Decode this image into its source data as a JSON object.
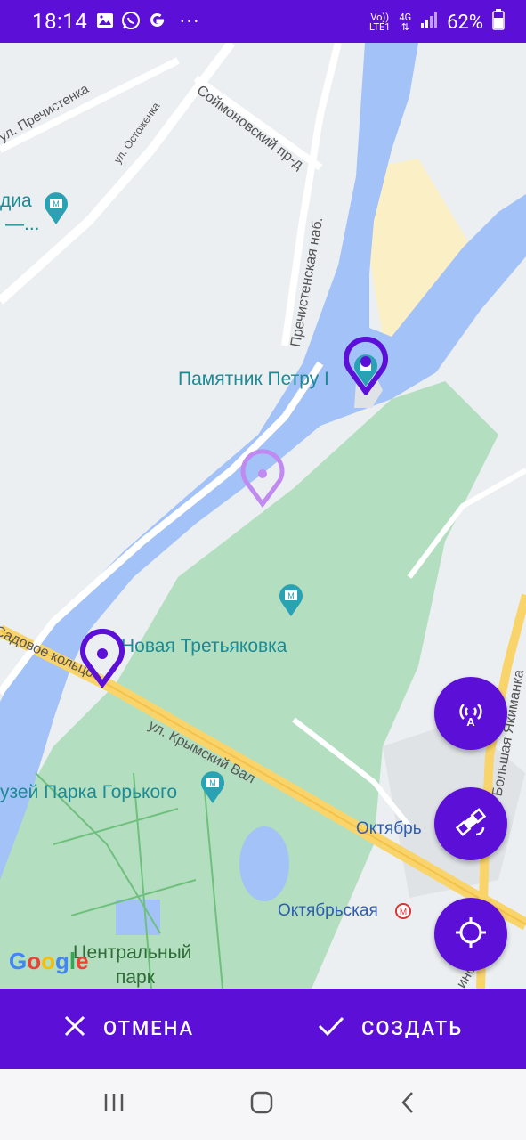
{
  "status_bar": {
    "time": "18:14",
    "network_vo": "Vo))",
    "network_lte": "LTE1",
    "network_4g": "4G",
    "battery": "62%",
    "icons": [
      "image-icon",
      "whatsapp-icon",
      "google-icon",
      "more-icon"
    ]
  },
  "map": {
    "labels": {
      "street_prechistenka": "ул. Пречистенка",
      "street_ostozhenka": "ул. Остоженка",
      "street_soimonovsky": "Соймоновский пр-д",
      "street_prechistenskaya": "Пречистенская наб.",
      "poi_media": "диа",
      "poi_media2": "—...",
      "poi_peter": "Памятник Петру I",
      "poi_tretyakovka": "Новая Третьяковка",
      "street_sadovoe": "Садовое кольцо",
      "street_krymsky": "ул. Крымский Вал",
      "poi_museum_gorky": "узей Парка Горького",
      "metro_oktyabrskaya_1": "Октябрь",
      "metro_oktyabrskaya_2": "Октябрьская",
      "park_central_1": "Центральный",
      "park_central_2": "парк",
      "street_bolshaya_yakimanka": "ул. Большая Якиманка",
      "street_bottom_right": "инс"
    },
    "google_logo": "Google"
  },
  "fabs": {
    "first_icon": "tower-broadcast-icon",
    "second_icon": "satellite-icon",
    "third_icon": "crosshair-location-icon"
  },
  "actions": {
    "cancel_label": "ОТМЕНА",
    "create_label": "СОЗДАТЬ"
  },
  "colors": {
    "primary": "#5c0fd6",
    "water": "#a3c2f7",
    "park": "#b3dfc0",
    "road_major": "#f9d46b"
  }
}
